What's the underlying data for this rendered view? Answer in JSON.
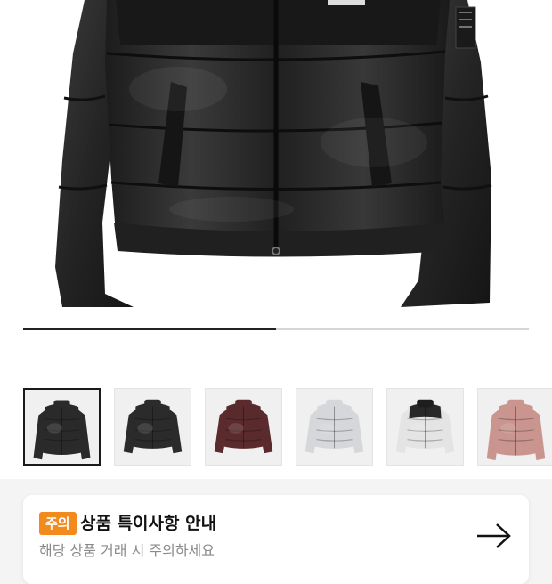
{
  "product": {
    "main_image_alt": "black down puffer jacket",
    "gallery_progress": 0.5
  },
  "thumbnails": [
    {
      "color": "#2a2a2a",
      "accent": "#2a2a2a",
      "cropped": false,
      "active": true
    },
    {
      "color": "#2b2b2b",
      "accent": "#2b2b2b",
      "cropped": true,
      "active": false
    },
    {
      "color": "#5a2a2c",
      "accent": "#5a2a2c",
      "cropped": true,
      "active": false
    },
    {
      "color": "#d5d7da",
      "accent": "#d5d7da",
      "cropped": true,
      "active": false
    },
    {
      "color": "#e4e4e4",
      "accent": "#1e1e1e",
      "cropped": true,
      "active": false
    },
    {
      "color": "#c9958e",
      "accent": "#c9958e",
      "cropped": false,
      "active": false
    }
  ],
  "notice": {
    "badge": "주의",
    "title": "상품 특이사항 안내",
    "subtitle": "해당 상품 거래 시 주의하세요",
    "arrow_icon": "arrow-right-icon"
  },
  "colors": {
    "badge": "#f28a1e",
    "background": "#f4f4f4"
  }
}
